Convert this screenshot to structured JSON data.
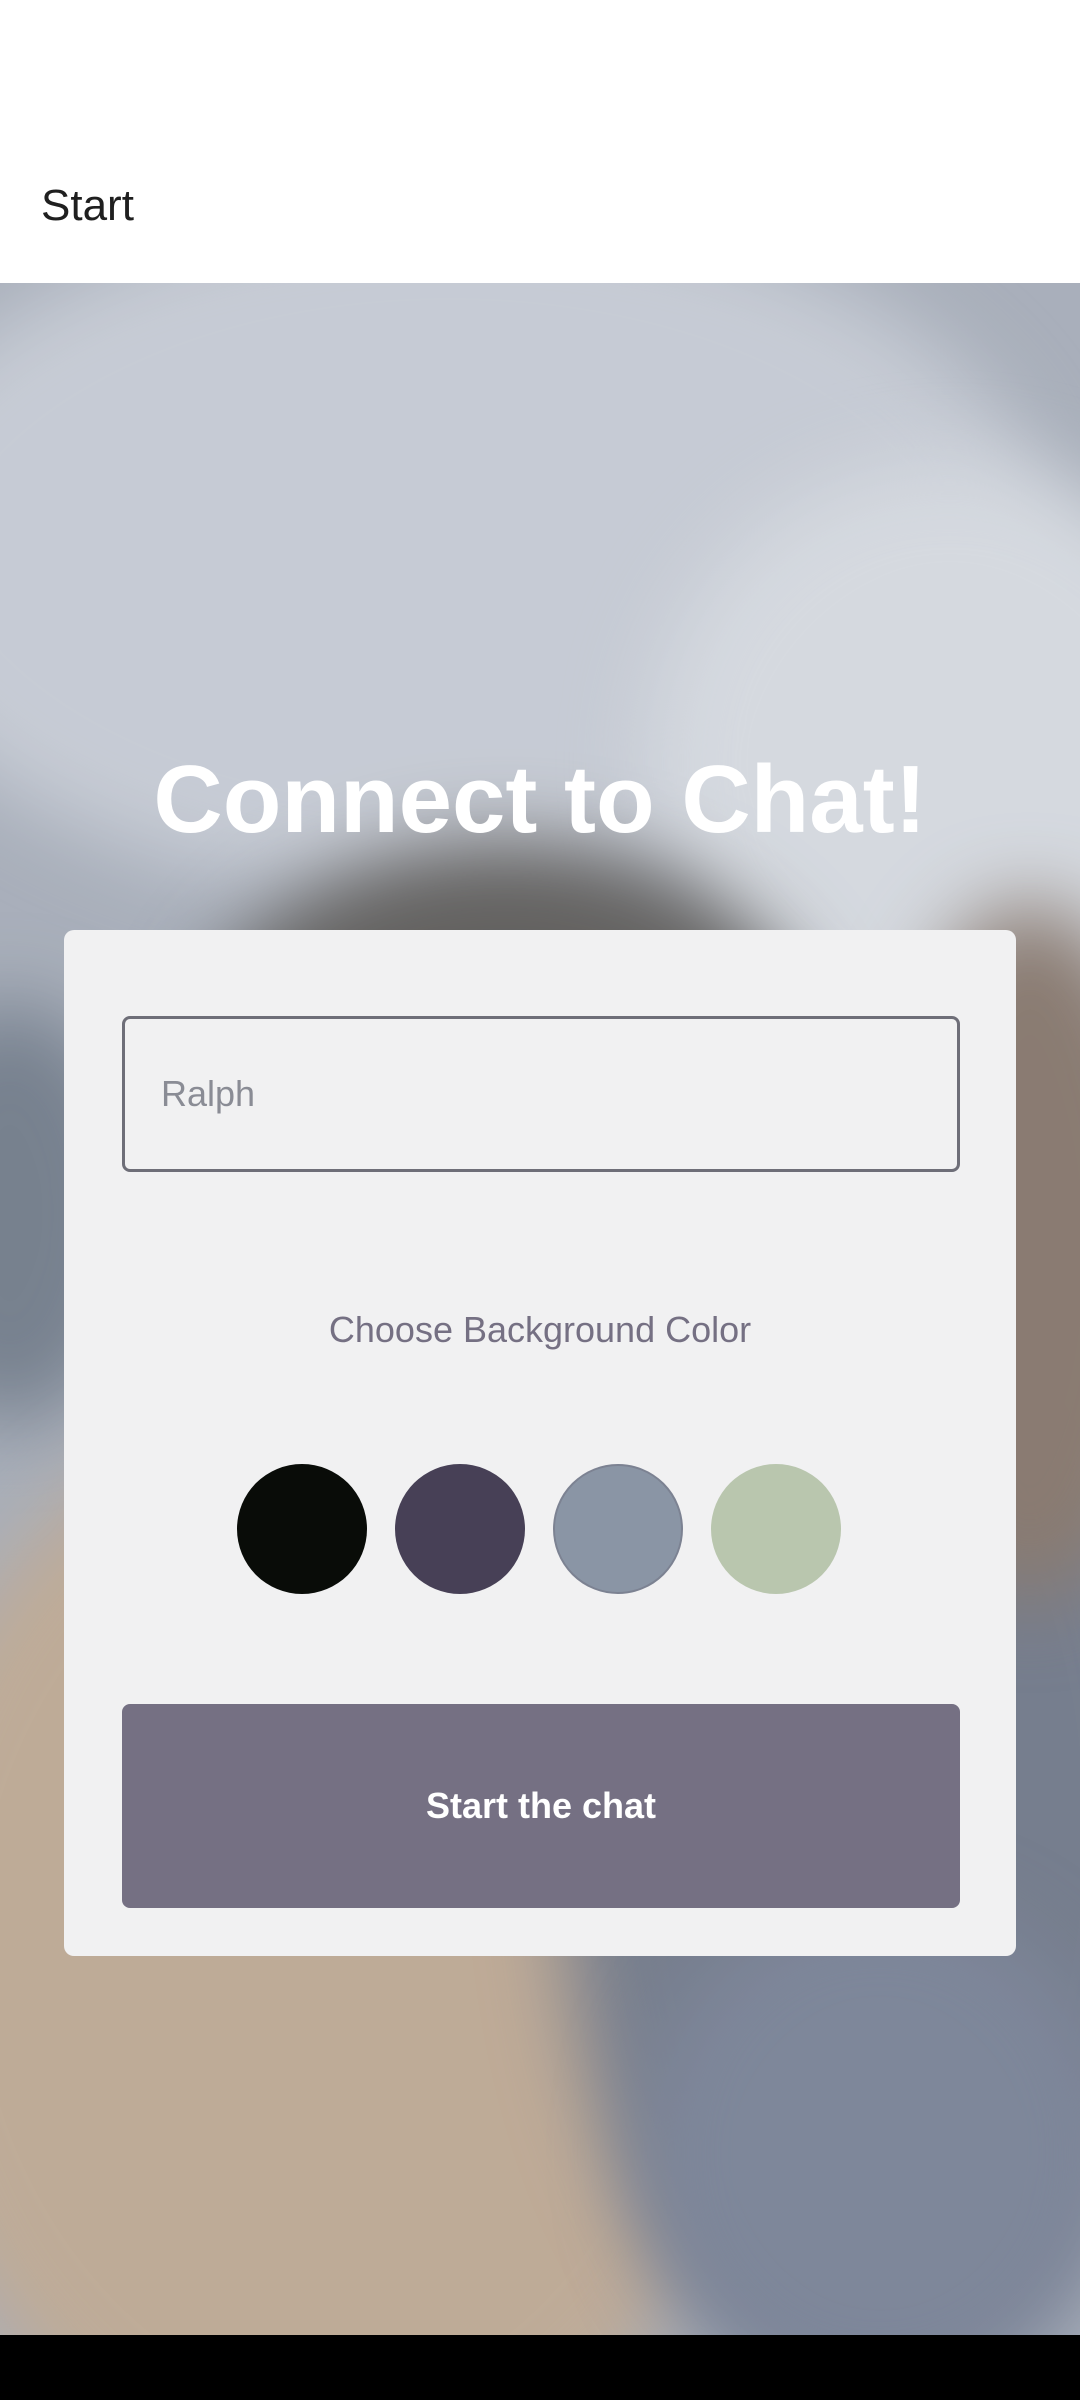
{
  "header": {
    "title": "Start"
  },
  "hero": {
    "title": "Connect to Chat!"
  },
  "form": {
    "name_input": {
      "value": "",
      "placeholder": "Ralph"
    },
    "color_label": "Choose Background Color",
    "color_options": [
      {
        "name": "black",
        "hex": "#090C08"
      },
      {
        "name": "dark-purple",
        "hex": "#474056"
      },
      {
        "name": "slate-gray",
        "hex": "#8A95A5"
      },
      {
        "name": "sage-green",
        "hex": "#B9C6AE"
      }
    ],
    "start_button_label": "Start the chat"
  },
  "colors": {
    "card_background": "#F1F1F2",
    "button_background": "#757083",
    "label_text": "#757083"
  }
}
